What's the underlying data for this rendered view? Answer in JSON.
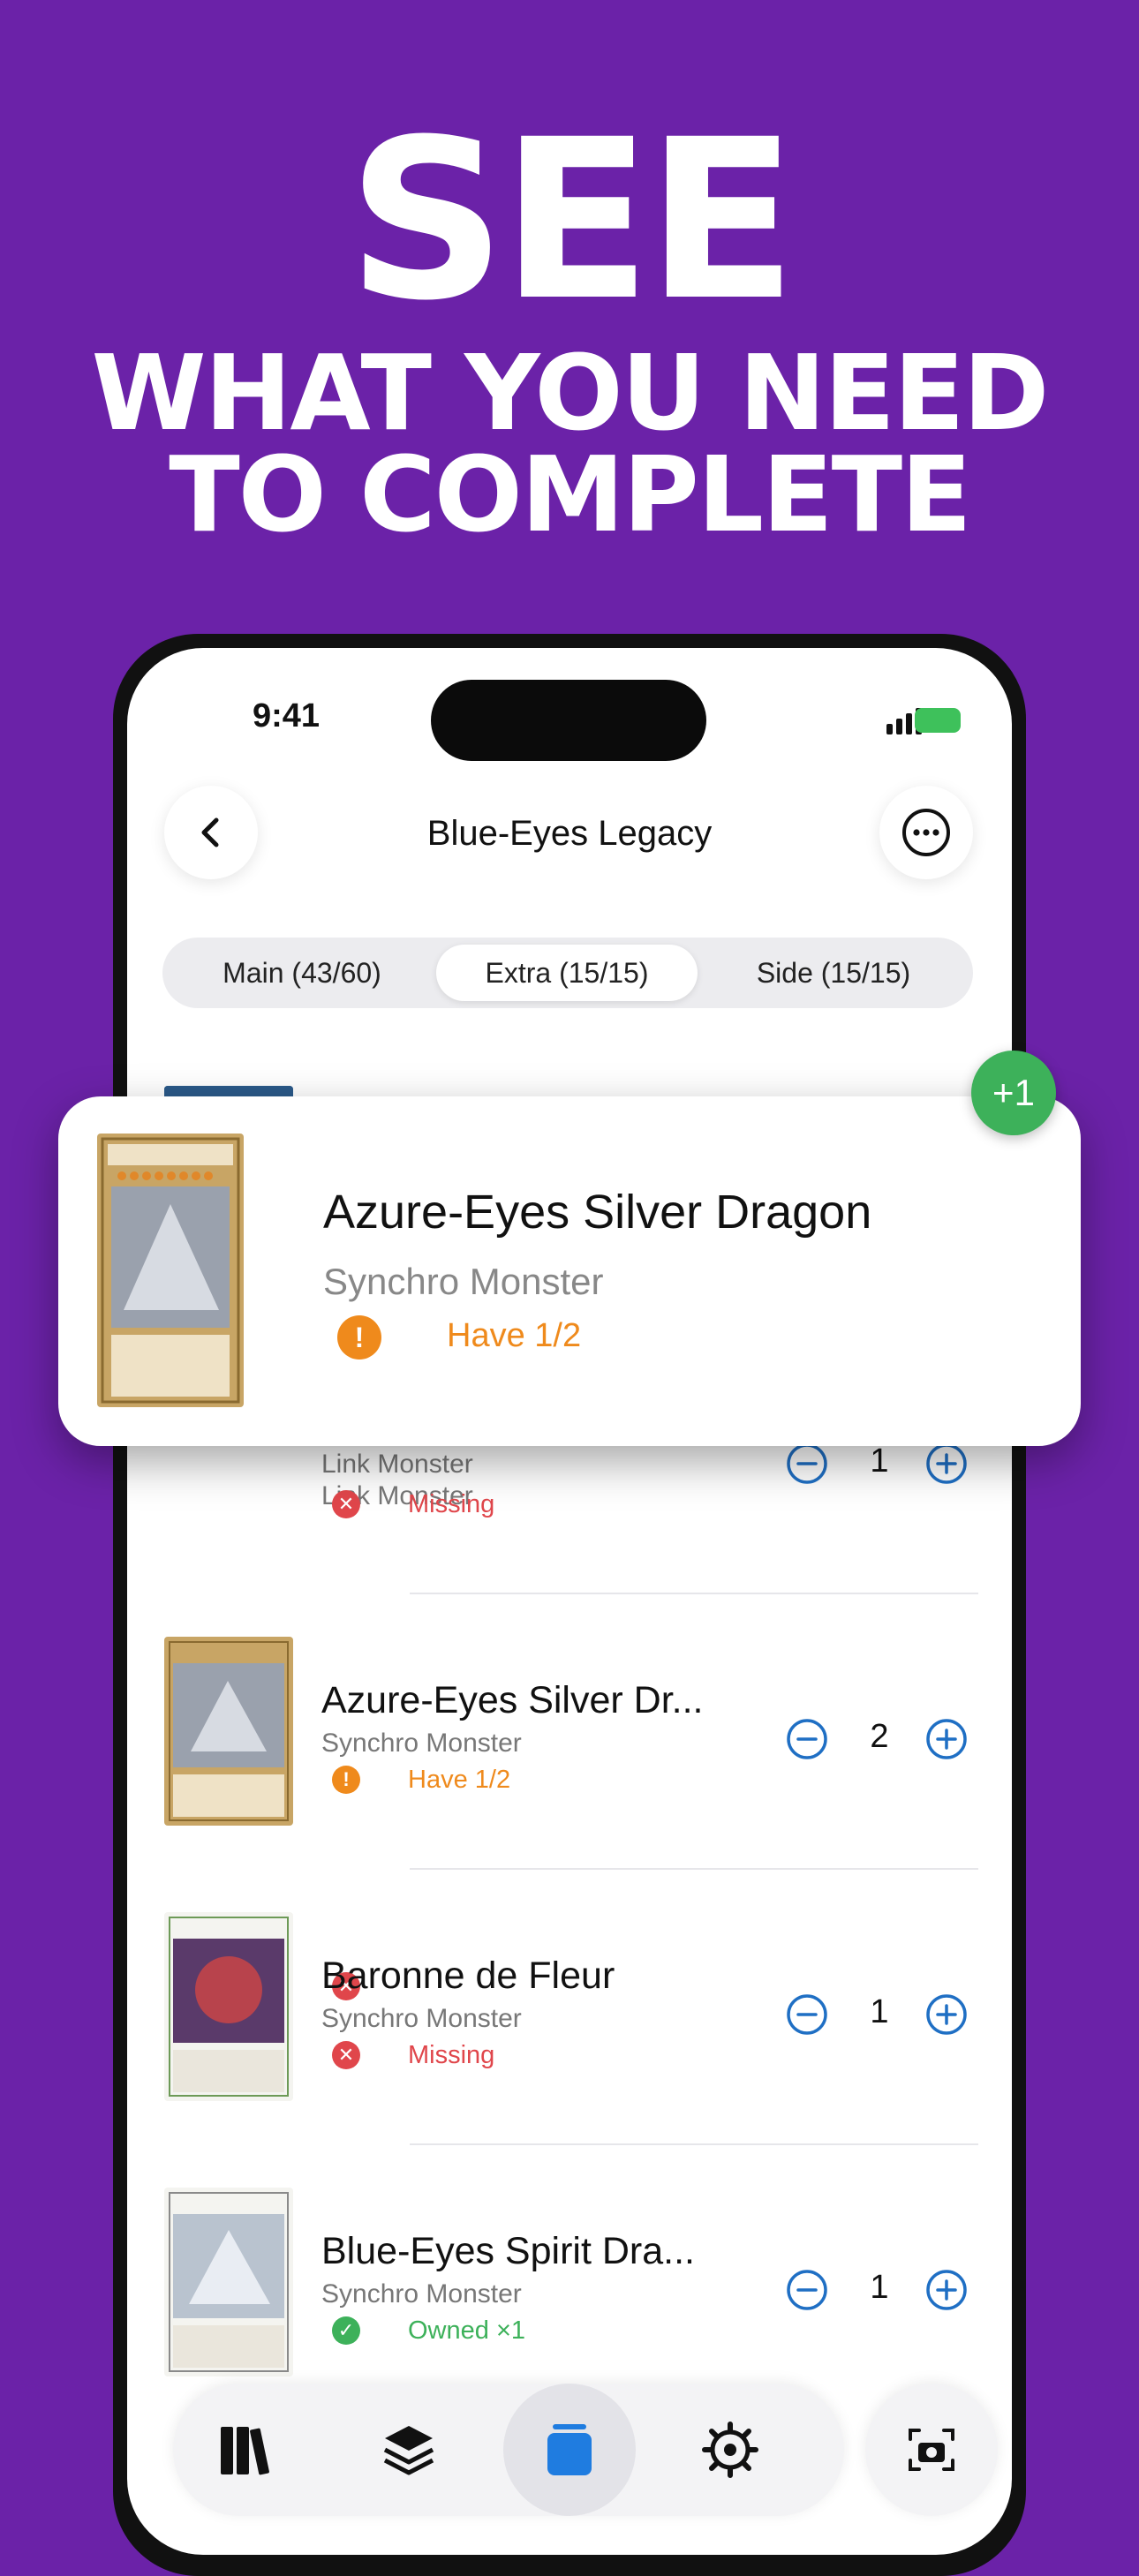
{
  "headline": {
    "line1": "SEE",
    "line2": "WHAT YOU NEED",
    "line3": "TO COMPLETE"
  },
  "status_bar": {
    "time": "9:41"
  },
  "nav": {
    "title": "Blue-Eyes Legacy",
    "back_icon": "chevron-left-icon",
    "more_icon": "ellipsis-circle-icon"
  },
  "segments": [
    {
      "label": "Main (43/60)",
      "active": false
    },
    {
      "label": "Extra (15/15)",
      "active": true
    },
    {
      "label": "Side (15/15)",
      "active": false
    }
  ],
  "rows": [
    {
      "name": "",
      "type": "Link Monster",
      "status": "Missing",
      "status_kind": "missing",
      "qty": "1"
    },
    {
      "name": "Azure-Eyes Silver Dr...",
      "type": "Synchro Monster",
      "status": "Have 1/2",
      "status_kind": "partial",
      "qty": "2"
    },
    {
      "name": "Baronne de Fleur",
      "type": "Synchro Monster",
      "status": "Missing",
      "status_kind": "missing",
      "qty": "1"
    },
    {
      "name": "Blue-Eyes Spirit Dra...",
      "type": "Synchro Monster",
      "status": "Owned ×1",
      "status_kind": "owned",
      "qty": "1"
    }
  ],
  "popup": {
    "name": "Azure-Eyes Silver Dragon",
    "type": "Synchro Monster",
    "status": "Have 1/2",
    "badge": "+1",
    "card_caption": "Azure-Eyes Silver Dragon"
  },
  "card_captions": {
    "row2": "Azure-Eyes Silver Dragon",
    "row3": "Baronne de Fleur",
    "row4": "Blue-Eyes Spirit Dragon"
  },
  "tabs": [
    {
      "icon": "library-icon",
      "active": false
    },
    {
      "icon": "layers-icon",
      "active": false
    },
    {
      "icon": "cards-icon",
      "active": true
    },
    {
      "icon": "settings-gear-icon",
      "active": false
    }
  ],
  "scan_icon": "camera-scan-icon",
  "colors": {
    "background": "#6b22a8",
    "missing": "#e0464b",
    "partial": "#ef8a1c",
    "owned": "#3db15a",
    "accent": "#1f6fc4",
    "active_tab": "#1f7ce0"
  }
}
